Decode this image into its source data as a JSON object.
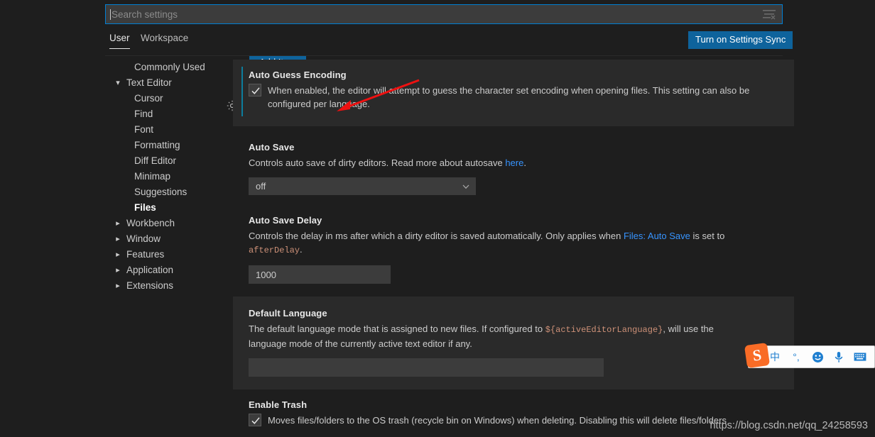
{
  "search": {
    "placeholder": "Search settings",
    "value": "",
    "filter_icon": "clear-filter-icon"
  },
  "tabs": [
    {
      "label": "User",
      "active": true
    },
    {
      "label": "Workspace",
      "active": false
    }
  ],
  "sync_button": {
    "label": "Turn on Settings Sync",
    "color": "#0e639c"
  },
  "toc": {
    "items": [
      {
        "label": "Commonly Used",
        "level": 1,
        "twisty": "",
        "selected": false
      },
      {
        "label": "Text Editor",
        "level": 0,
        "twisty": "chevron-down",
        "selected": false
      },
      {
        "label": "Cursor",
        "level": 1,
        "twisty": "",
        "selected": false
      },
      {
        "label": "Find",
        "level": 1,
        "twisty": "",
        "selected": false
      },
      {
        "label": "Font",
        "level": 1,
        "twisty": "",
        "selected": false
      },
      {
        "label": "Formatting",
        "level": 1,
        "twisty": "",
        "selected": false
      },
      {
        "label": "Diff Editor",
        "level": 1,
        "twisty": "",
        "selected": false
      },
      {
        "label": "Minimap",
        "level": 1,
        "twisty": "",
        "selected": false
      },
      {
        "label": "Suggestions",
        "level": 1,
        "twisty": "",
        "selected": false
      },
      {
        "label": "Files",
        "level": 1,
        "twisty": "",
        "selected": true
      },
      {
        "label": "Workbench",
        "level": 0,
        "twisty": "chevron-right",
        "selected": false
      },
      {
        "label": "Window",
        "level": 0,
        "twisty": "chevron-right",
        "selected": false
      },
      {
        "label": "Features",
        "level": 0,
        "twisty": "chevron-right",
        "selected": false
      },
      {
        "label": "Application",
        "level": 0,
        "twisty": "chevron-right",
        "selected": false
      },
      {
        "label": "Extensions",
        "level": 0,
        "twisty": "chevron-right",
        "selected": false
      }
    ]
  },
  "add_item_button": {
    "label": "Add Item"
  },
  "settings": {
    "auto_guess_encoding": {
      "title": "Auto Guess Encoding",
      "desc_1": "When enabled, the editor will attempt to guess the character set encoding when opening files. This setting can also be configured per language.",
      "checked": true,
      "modified": true,
      "highlighted": true
    },
    "auto_save": {
      "title": "Auto Save",
      "desc_1": "Controls auto save of dirty editors. Read more about autosave ",
      "desc_link": "here",
      "desc_2": ".",
      "value": "off"
    },
    "auto_save_delay": {
      "title": "Auto Save Delay",
      "desc_1": "Controls the delay in ms after which a dirty editor is saved automatically. Only applies when ",
      "desc_link": "Files: Auto Save",
      "desc_2": " is set to ",
      "desc_code": "afterDelay",
      "desc_3": ".",
      "value": "1000"
    },
    "default_language": {
      "title": "Default Language",
      "desc_1": "The default language mode that is assigned to new files. If configured to ",
      "desc_code": "${activeEditorLanguage}",
      "desc_2": ", will use the language mode of the currently active text editor if any.",
      "value": ""
    },
    "enable_trash": {
      "title": "Enable Trash",
      "desc_1": "Moves files/folders to the OS trash (recycle bin on Windows) when deleting. Disabling this will delete files/folders",
      "checked": true
    }
  },
  "ime": {
    "logo": "sogou-logo",
    "items": [
      {
        "icon": "chinese-mode-icon",
        "glyph": "中",
        "gray": false
      },
      {
        "icon": "punctuation-icon",
        "glyph": "°,",
        "gray": false
      },
      {
        "icon": "emoji-icon",
        "glyph": "☺",
        "gray": false
      },
      {
        "icon": "microphone-icon",
        "glyph": "ƨ",
        "gray": false
      },
      {
        "icon": "keyboard-icon",
        "glyph": "⌨",
        "gray": false
      },
      {
        "icon": "user-icon",
        "glyph": "⚹",
        "gray": true
      },
      {
        "icon": "toolbox-icon",
        "glyph": "❖",
        "gray": false
      }
    ]
  },
  "watermark": {
    "text": "https://blog.csdn.net/qq_24258593"
  }
}
